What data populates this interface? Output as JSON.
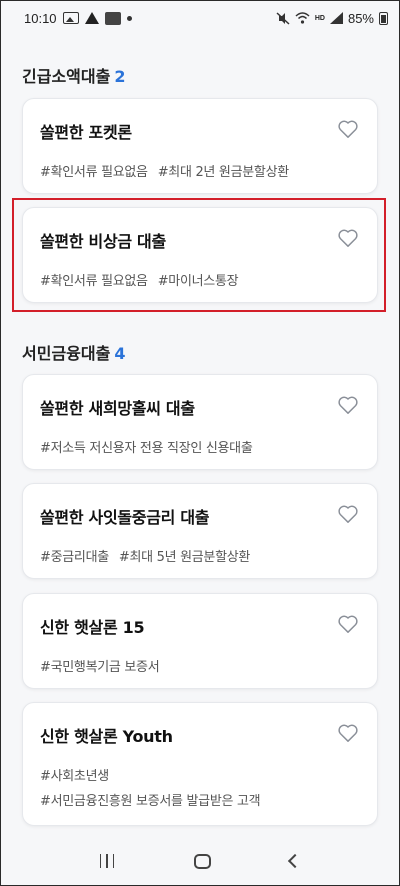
{
  "status_bar": {
    "time": "10:10",
    "battery": "85%",
    "network_label": "HD"
  },
  "sections": [
    {
      "title": "긴급소액대출",
      "count": "2",
      "cards": [
        {
          "title": "쏠편한 포켓론",
          "tags": [
            "#확인서류 필요없음",
            "#최대 2년 원금분할상환"
          ]
        },
        {
          "title": "쏠편한 비상금 대출",
          "tags": [
            "#확인서류 필요없음",
            "#마이너스통장"
          ]
        }
      ]
    },
    {
      "title": "서민금융대출",
      "count": "4",
      "cards": [
        {
          "title": "쏠편한 새희망홀씨 대출",
          "tags": [
            "#저소득 저신용자 전용 직장인 신용대출"
          ]
        },
        {
          "title": "쏠편한 사잇돌중금리 대출",
          "tags": [
            "#중금리대출",
            "#최대 5년 원금분할상환"
          ]
        },
        {
          "title": "신한 햇살론 15",
          "tags": [
            "#국민행복기금 보증서"
          ]
        },
        {
          "title": "신한 햇살론 Youth",
          "tags": [
            "#사회초년생",
            "#서민금융진흥원 보증서를 발급받은 고객"
          ]
        }
      ]
    }
  ],
  "colors": {
    "accent": "#2b73d9",
    "highlight_border": "#d31f2a",
    "background": "#f6f7f9"
  }
}
